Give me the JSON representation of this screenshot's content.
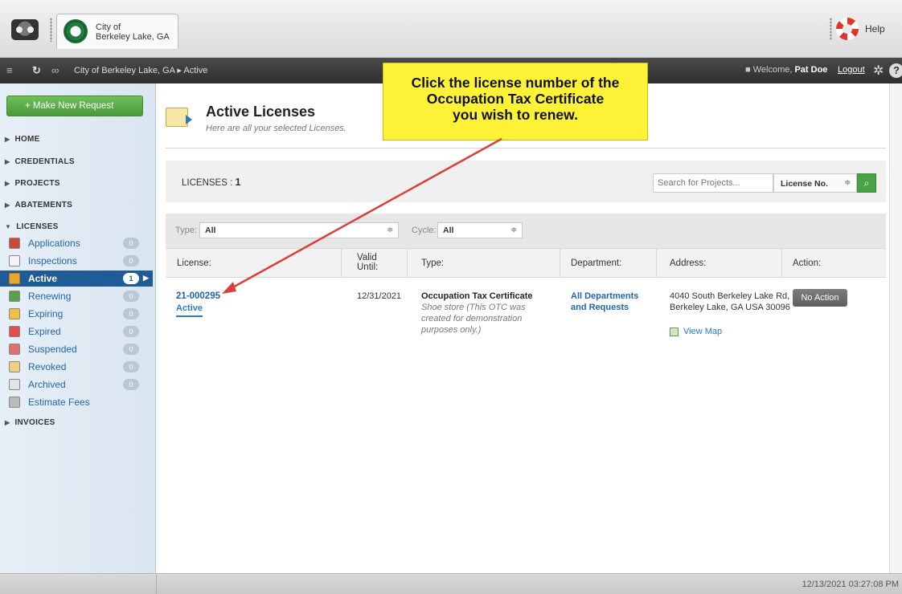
{
  "header": {
    "org_name_line1": "City of",
    "org_name_line2": "Berkeley Lake, GA",
    "help_label": "Help"
  },
  "navbar": {
    "breadcrumb": "City of Berkeley Lake, GA ▸ Active",
    "welcome_prefix": "Welcome,",
    "user_name": "Pat Doe",
    "logout_label": "Logout"
  },
  "sidebar": {
    "new_request_label": "+ Make New Request",
    "sections": {
      "home": "HOME",
      "credentials": "CREDENTIALS",
      "projects": "PROJECTS",
      "abatements": "ABATEMENTS",
      "licenses": "LICENSES",
      "invoices": "INVOICES"
    },
    "license_items": [
      {
        "label": "Applications",
        "count": "0"
      },
      {
        "label": "Inspections",
        "count": "0"
      },
      {
        "label": "Active",
        "count": "1"
      },
      {
        "label": "Renewing",
        "count": "0"
      },
      {
        "label": "Expiring",
        "count": "0"
      },
      {
        "label": "Expired",
        "count": "0"
      },
      {
        "label": "Suspended",
        "count": "0"
      },
      {
        "label": "Revoked",
        "count": "0"
      },
      {
        "label": "Archived",
        "count": "0"
      },
      {
        "label": "Estimate Fees"
      }
    ]
  },
  "main": {
    "title": "Active Licenses",
    "subtitle": "Here are all your selected Licenses.",
    "count_label": "LICENSES :",
    "count_value": "1",
    "search_placeholder": "Search for Projects...",
    "search_type": "License No.",
    "filters": {
      "type_label": "Type:",
      "type_value": "All",
      "cycle_label": "Cycle:",
      "cycle_value": "All"
    },
    "columns": {
      "license": "License:",
      "valid_until_1": "Valid",
      "valid_until_2": "Until:",
      "type": "Type:",
      "department": "Department:",
      "address": "Address:",
      "action": "Action:"
    },
    "rows": [
      {
        "license_no": "21-000295",
        "status": "Active",
        "valid_until": "12/31/2021",
        "type_name": "Occupation Tax Certificate",
        "type_desc": "Shoe store (This OTC was created for demonstration purposes only.)",
        "department": "All Departments and Requests",
        "address": "4040 South Berkeley Lake Rd, Berkeley Lake, GA USA 30096",
        "view_map": "View Map",
        "action": "No Action"
      }
    ]
  },
  "callout": {
    "line1": "Click the license number of the",
    "line2": "Occupation Tax Certificate",
    "line3": "you wish to renew.",
    "color": "#fdf235",
    "arrow_color": "#d9403a"
  },
  "statusbar": {
    "datetime": "12/13/2021 03:27:08 PM"
  }
}
